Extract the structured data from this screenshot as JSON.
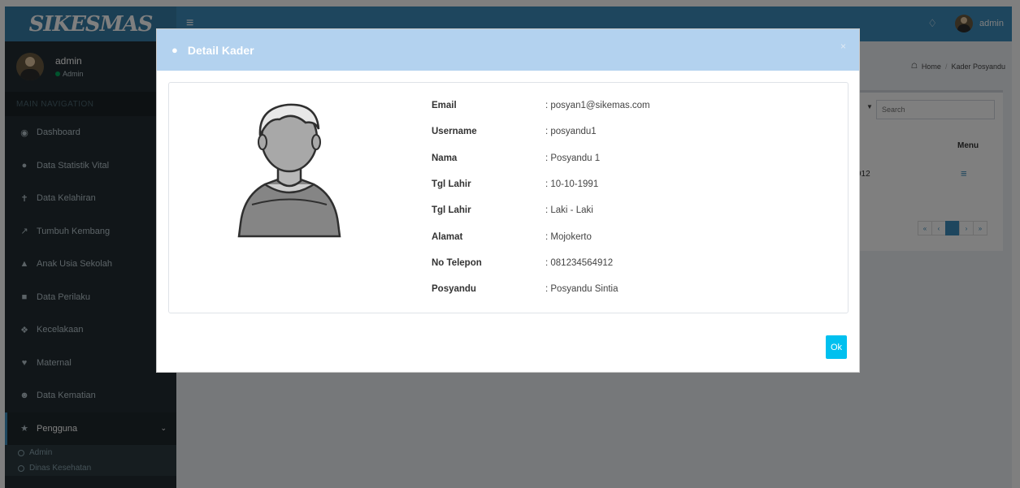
{
  "app": {
    "logo": "SIKESMAS"
  },
  "user_panel": {
    "name": "admin",
    "status": "Admin"
  },
  "sidebar": {
    "header": "MAIN NAVIGATION",
    "items": [
      {
        "label": "Dashboard",
        "icon": "dashboard-icon"
      },
      {
        "label": "Data Statistik Vital",
        "icon": "user-icon"
      },
      {
        "label": "Data Kelahiran",
        "icon": "baby-icon"
      },
      {
        "label": "Tumbuh Kembang",
        "icon": "chart-icon"
      },
      {
        "label": "Anak Usia Sekolah",
        "icon": "school-icon"
      },
      {
        "label": "Data Perilaku",
        "icon": "people-icon"
      },
      {
        "label": "Kecelakaan",
        "icon": "alert-icon"
      },
      {
        "label": "Maternal",
        "icon": "heart-icon"
      },
      {
        "label": "Data Kematian",
        "icon": "users-icon"
      },
      {
        "label": "Pengguna",
        "icon": "group-icon"
      }
    ],
    "sub_items": [
      {
        "label": "Admin"
      },
      {
        "label": "Dinas Kesehatan"
      }
    ]
  },
  "navbar": {
    "user": "admin"
  },
  "breadcrumb": {
    "home": "Home",
    "current": "Kader Posyandu"
  },
  "table": {
    "search_placeholder": "Search",
    "menu_header": "Menu",
    "row_phone_fragment": "912"
  },
  "modal": {
    "title": "Detail Kader",
    "close": "×",
    "ok": "Ok",
    "fields": [
      {
        "label": "Email",
        "value": ": posyan1@sikemas.com"
      },
      {
        "label": "Username",
        "value": ": posyandu1"
      },
      {
        "label": "Nama",
        "value": ": Posyandu 1"
      },
      {
        "label": "Tgl Lahir",
        "value": ": 10-10-1991"
      },
      {
        "label": "Tgl Lahir",
        "value": ": Laki - Laki"
      },
      {
        "label": "Alamat",
        "value": ": Mojokerto"
      },
      {
        "label": "No Telepon",
        "value": ": 081234564912"
      },
      {
        "label": "Posyandu",
        "value": ": Posyandu Sintia"
      }
    ]
  },
  "colors": {
    "header_blue": "#3c8dbc",
    "sidebar_dark": "#222d32",
    "modal_header": "#b3d2ef",
    "ok_button": "#00c0ef"
  }
}
